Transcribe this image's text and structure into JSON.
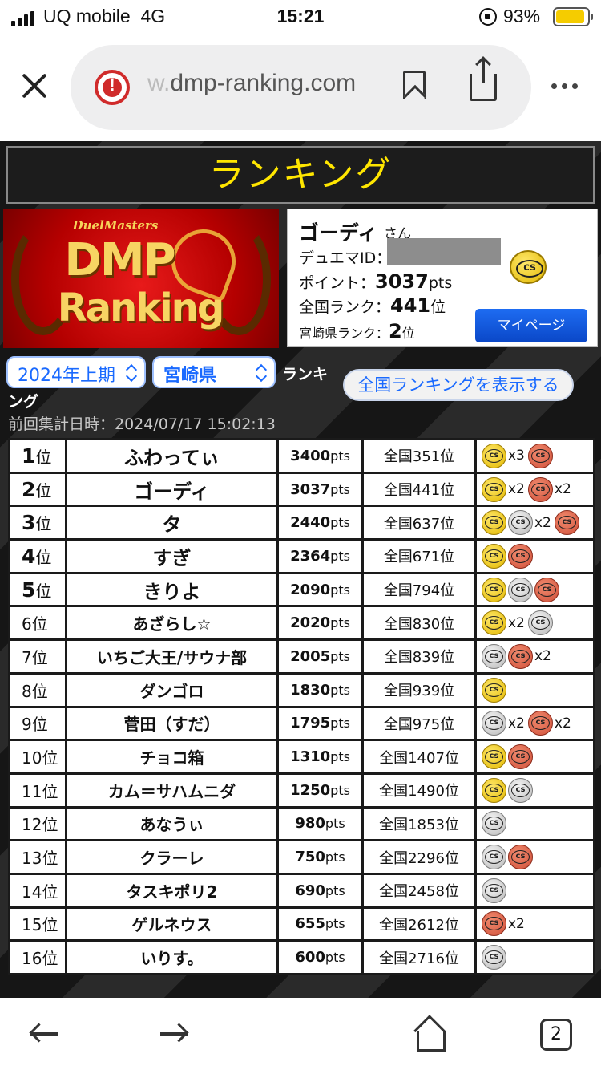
{
  "status_bar": {
    "carrier": "UQ mobile",
    "network": "4G",
    "time": "15:21",
    "battery_percent": "93%",
    "battery_level": 0.93
  },
  "browser": {
    "url_faded": "w.",
    "url_main": "dmp-ranking.com",
    "warning_glyph": "!",
    "tab_count": "2"
  },
  "page": {
    "title": "ランキング",
    "logo": {
      "top_text": "DuelMasters",
      "main_text": "DMP",
      "sub_text": "Ranking"
    },
    "profile": {
      "name": "ゴーディ",
      "honorific": "さん",
      "id_label": "デュエマID：",
      "points_label": "ポイント：",
      "points_value": "3037",
      "points_unit": "pts",
      "national_label": "全国ランク：",
      "national_value": "441",
      "national_unit": "位",
      "prefecture_label": "宮崎県ランク：",
      "prefecture_value": "2",
      "prefecture_unit": "位",
      "mypage_button": "マイページ"
    },
    "filters": {
      "period": "2024年上期",
      "prefecture": "宮崎県",
      "ranking_label_1": "ランキ",
      "ranking_label_2": "ング",
      "national_button": "全国ランキングを表示する"
    },
    "last_updated": "前回集計日時：2024/07/17 15:02:13",
    "rank_suffix": "位",
    "pts_suffix": "pts",
    "rows": [
      {
        "rank": "1",
        "name": "ふわってぃ",
        "pts": "3400",
        "national": "全国351位",
        "badges": [
          {
            "type": "gold",
            "count": "x3"
          },
          {
            "type": "red",
            "count": ""
          }
        ]
      },
      {
        "rank": "2",
        "name": "ゴーディ",
        "pts": "3037",
        "national": "全国441位",
        "badges": [
          {
            "type": "gold",
            "count": "x2"
          },
          {
            "type": "red",
            "count": "x2"
          }
        ]
      },
      {
        "rank": "3",
        "name": "タ",
        "pts": "2440",
        "national": "全国637位",
        "badges": [
          {
            "type": "gold",
            "count": ""
          },
          {
            "type": "silver",
            "count": "x2"
          },
          {
            "type": "red",
            "count": ""
          }
        ]
      },
      {
        "rank": "4",
        "name": "すぎ",
        "pts": "2364",
        "national": "全国671位",
        "badges": [
          {
            "type": "gold",
            "count": ""
          },
          {
            "type": "red",
            "count": ""
          }
        ]
      },
      {
        "rank": "5",
        "name": "きりよ",
        "pts": "2090",
        "national": "全国794位",
        "badges": [
          {
            "type": "gold",
            "count": ""
          },
          {
            "type": "silver",
            "count": ""
          },
          {
            "type": "red",
            "count": ""
          }
        ]
      },
      {
        "rank": "6",
        "name": "あざらし☆",
        "pts": "2020",
        "national": "全国830位",
        "badges": [
          {
            "type": "gold",
            "count": "x2"
          },
          {
            "type": "silver",
            "count": ""
          }
        ]
      },
      {
        "rank": "7",
        "name": "いちご大王/サウナ部",
        "pts": "2005",
        "national": "全国839位",
        "badges": [
          {
            "type": "silver",
            "count": ""
          },
          {
            "type": "red",
            "count": "x2"
          }
        ]
      },
      {
        "rank": "8",
        "name": "ダンゴロ",
        "pts": "1830",
        "national": "全国939位",
        "badges": [
          {
            "type": "gold",
            "count": ""
          }
        ]
      },
      {
        "rank": "9",
        "name": "菅田（すだ）",
        "pts": "1795",
        "national": "全国975位",
        "badges": [
          {
            "type": "silver",
            "count": "x2"
          },
          {
            "type": "red",
            "count": "x2"
          }
        ]
      },
      {
        "rank": "10",
        "name": "チョコ箱",
        "pts": "1310",
        "national": "全国1407位",
        "badges": [
          {
            "type": "gold",
            "count": ""
          },
          {
            "type": "red",
            "count": ""
          }
        ]
      },
      {
        "rank": "11",
        "name": "カム＝サハムニダ",
        "pts": "1250",
        "national": "全国1490位",
        "badges": [
          {
            "type": "gold",
            "count": ""
          },
          {
            "type": "silver",
            "count": ""
          }
        ]
      },
      {
        "rank": "12",
        "name": "あなうぃ",
        "pts": "980",
        "national": "全国1853位",
        "badges": [
          {
            "type": "silver",
            "count": ""
          }
        ]
      },
      {
        "rank": "13",
        "name": "クラーレ",
        "pts": "750",
        "national": "全国2296位",
        "badges": [
          {
            "type": "silver",
            "count": ""
          },
          {
            "type": "red",
            "count": ""
          }
        ]
      },
      {
        "rank": "14",
        "name": "タスキポリ2",
        "pts": "690",
        "national": "全国2458位",
        "badges": [
          {
            "type": "silver",
            "count": ""
          }
        ]
      },
      {
        "rank": "15",
        "name": "ゲルネウス",
        "pts": "655",
        "national": "全国2612位",
        "badges": [
          {
            "type": "red",
            "count": "x2"
          }
        ]
      },
      {
        "rank": "16",
        "name": "いりす。",
        "pts": "600",
        "national": "全国2716位",
        "badges": [
          {
            "type": "silver",
            "count": ""
          }
        ]
      }
    ]
  },
  "icons": {
    "signal": "signal-icon",
    "lock": "rotation-lock-icon",
    "battery": "battery-icon",
    "close": "close-icon",
    "warning": "warning-icon",
    "bookmark": "bookmark-icon",
    "share": "share-icon",
    "more": "more-icon",
    "back": "back-arrow-icon",
    "forward": "forward-arrow-icon",
    "home": "home-icon",
    "tabs": "tabs-icon"
  },
  "colors": {
    "title_text": "#ffe600",
    "link_blue": "#1a6aff",
    "mypage_button": "#0a47c7",
    "battery": "#f5cc00",
    "warning": "#d02b2b"
  }
}
